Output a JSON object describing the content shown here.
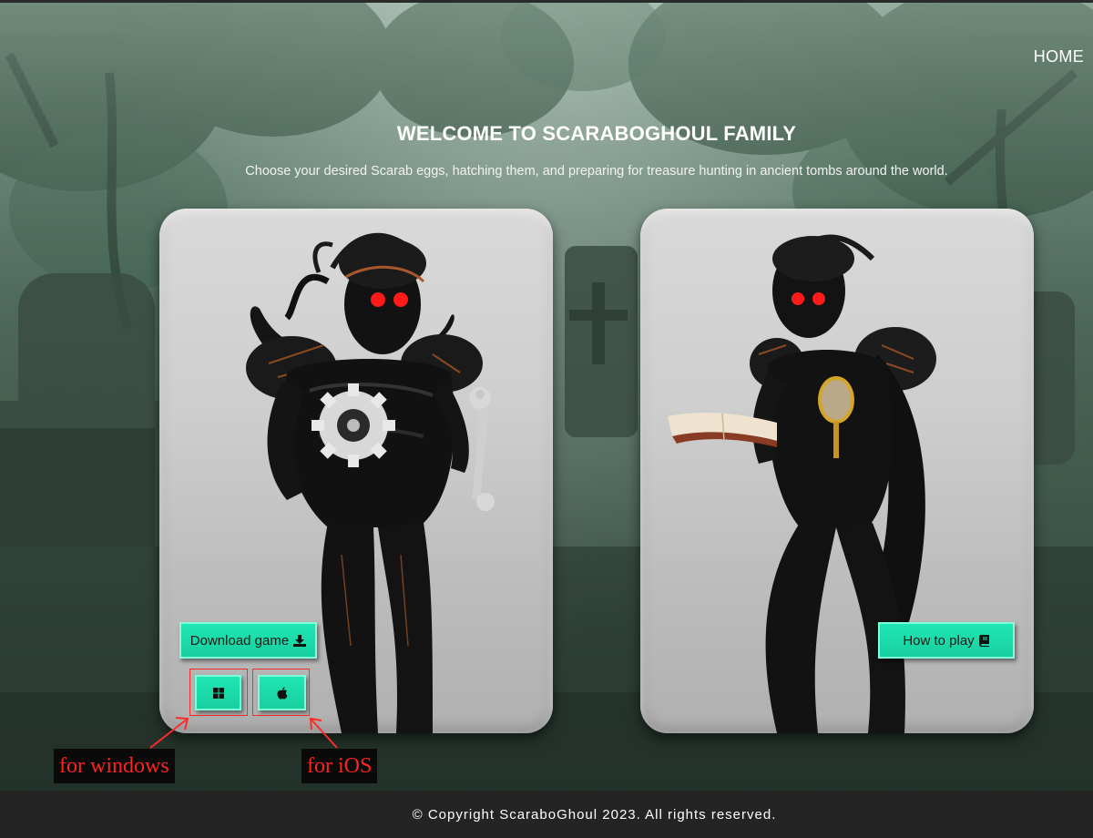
{
  "nav": {
    "home_label": "HOME"
  },
  "hero": {
    "title": "WELCOME TO SCARABOGHOUL FAMILY",
    "subtitle": "Choose your desired Scarab eggs, hatching them, and preparing for treasure hunting in ancient tombs around the world."
  },
  "cards": {
    "left": {
      "download_label": "Download game",
      "download_icon": "download-icon",
      "windows_icon": "windows-icon",
      "ios_icon": "apple-icon"
    },
    "right": {
      "howto_label": "How to play",
      "howto_icon": "book-icon"
    }
  },
  "annotations": {
    "windows_label": "for windows",
    "ios_label": "for iOS",
    "color": "#ff2222"
  },
  "footer": {
    "copyright": "© Copyright ScaraboGhoul 2023. All rights reserved."
  },
  "colors": {
    "button_fill": "#1fe6b4",
    "button_border": "#7effd9",
    "footer_bg": "#242424"
  }
}
